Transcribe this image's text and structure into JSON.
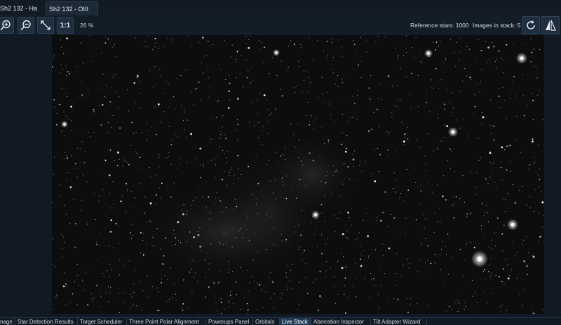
{
  "tabs": {
    "items": [
      {
        "label": "Sh2 132 - Ha"
      },
      {
        "label": "Sh2 132 - OIII"
      }
    ],
    "active_index": 1
  },
  "toolbar": {
    "zoom_in_icon": "zoom-in-icon",
    "zoom_out_icon": "zoom-out-icon",
    "fit_icon": "fit-to-window-icon",
    "one_to_one_label": "1:1",
    "zoom_level": "26 %",
    "reference_stars": "Reference stars: 1000",
    "images_in_stack": "Images in stack: 5",
    "refresh_icon": "refresh-icon",
    "flip_icon": "flip-icon"
  },
  "bottom_tabs": {
    "items": [
      {
        "label": "nage"
      },
      {
        "label": "Star Detection Results"
      },
      {
        "label": "Target Scheduler"
      },
      {
        "label": "Three Point Polar Alignment"
      },
      {
        "label": "Powerups Panel"
      },
      {
        "label": "Orbitals"
      },
      {
        "label": "Live Stack"
      },
      {
        "label": "Aberration Inspector"
      },
      {
        "label": "Tilt Adapter Wizard"
      }
    ],
    "active_index": 6
  },
  "colors": {
    "accent": "#1f3a52",
    "background": "#111a24",
    "image_background": "#0d0d0f"
  }
}
